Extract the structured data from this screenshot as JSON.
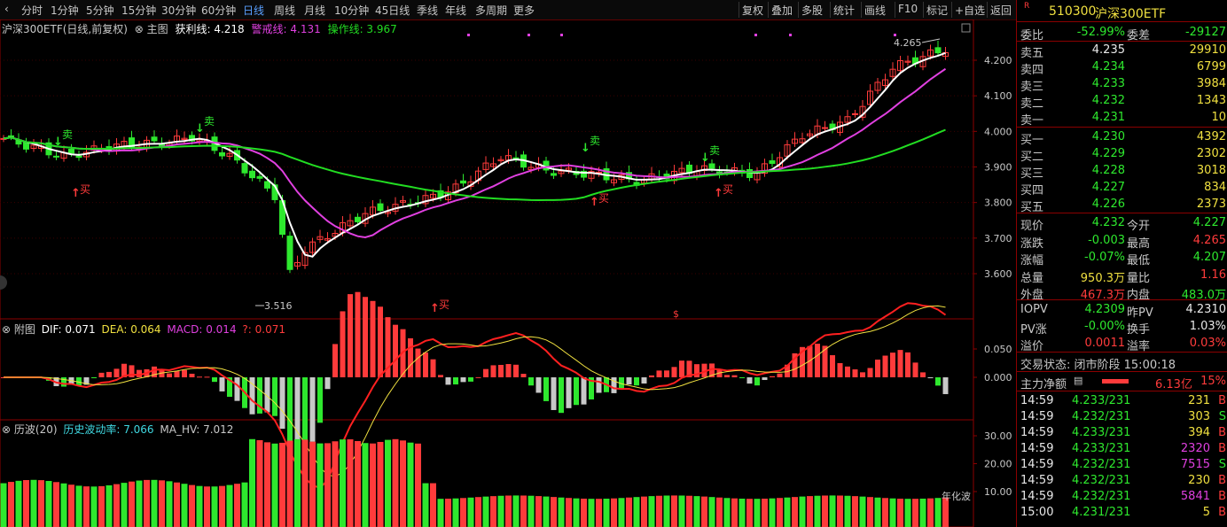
{
  "toolbar": {
    "periods": [
      "分时",
      "1分钟",
      "5分钟",
      "15分钟",
      "30分钟",
      "60分钟",
      "日线",
      "周线",
      "月线",
      "10分钟",
      "45日线",
      "季线",
      "年线",
      "多周期",
      "更多"
    ],
    "active_period": "日线",
    "right_buttons": [
      "复权",
      "叠加",
      "多股",
      "统计",
      "画线",
      "F10",
      "标记",
      "+自选",
      "返回"
    ]
  },
  "main_header": {
    "title": "沪深300ETF(日线,前复权)",
    "label": "主图",
    "profit_line": "获利线: 4.218",
    "warn_line": "警戒线: 4.131",
    "op_line": "操作线: 3.967"
  },
  "main_chart": {
    "y_ticks": [
      "4.200",
      "4.100",
      "4.000",
      "3.900",
      "3.800",
      "3.700",
      "3.600"
    ],
    "high_label": "4.265",
    "low_label": "3.516",
    "signals": [
      {
        "text": "卖",
        "kind": "sell"
      },
      {
        "text": "买",
        "kind": "buy"
      },
      {
        "text": "卖",
        "kind": "sell"
      },
      {
        "text": "买",
        "kind": "buy"
      },
      {
        "text": "卖",
        "kind": "sell"
      },
      {
        "text": "买",
        "kind": "buy"
      },
      {
        "text": "卖",
        "kind": "sell"
      },
      {
        "text": "买",
        "kind": "buy"
      }
    ],
    "dollar_mark": "$"
  },
  "macd_header": {
    "label": "附图",
    "dif": "DIF: 0.071",
    "dea": "DEA: 0.064",
    "macd": "MACD: 0.014",
    "extra": "?: 0.071"
  },
  "macd_chart": {
    "y_ticks": [
      "0.050",
      "0.000"
    ]
  },
  "vol_header": {
    "label": "历波(20)",
    "hv": "历史波动率: 7.066",
    "ma_hv": "MA_HV: 7.012"
  },
  "vol_chart": {
    "y_ticks": [
      "30.00",
      "20.00",
      "10.00"
    ],
    "annual_label": "年化波"
  },
  "quote": {
    "code": "510300",
    "name": "沪深300ETF",
    "ratio_label": "委比",
    "ratio": "-52.99%",
    "diff_label": "委差",
    "diff": "-29127",
    "asks": [
      {
        "label": "卖五",
        "price": "4.235",
        "vol": "29910"
      },
      {
        "label": "卖四",
        "price": "4.234",
        "vol": "6799"
      },
      {
        "label": "卖三",
        "price": "4.233",
        "vol": "3984"
      },
      {
        "label": "卖二",
        "price": "4.232",
        "vol": "1343"
      },
      {
        "label": "卖一",
        "price": "4.231",
        "vol": "10"
      }
    ],
    "bids": [
      {
        "label": "买一",
        "price": "4.230",
        "vol": "4392"
      },
      {
        "label": "买二",
        "price": "4.229",
        "vol": "2302"
      },
      {
        "label": "买三",
        "price": "4.228",
        "vol": "3018"
      },
      {
        "label": "买四",
        "price": "4.227",
        "vol": "834"
      },
      {
        "label": "买五",
        "price": "4.226",
        "vol": "2373"
      }
    ],
    "stats": [
      {
        "l1": "现价",
        "v1": "4.232",
        "l2": "今开",
        "v2": "4.227"
      },
      {
        "l1": "涨跌",
        "v1": "-0.003",
        "l2": "最高",
        "v2": "4.265"
      },
      {
        "l1": "涨幅",
        "v1": "-0.07%",
        "l2": "最低",
        "v2": "4.207"
      },
      {
        "l1": "总量",
        "v1": "950.3万",
        "l2": "量比",
        "v2": "1.16"
      },
      {
        "l1": "外盘",
        "v1": "467.3万",
        "l2": "内盘",
        "v2": "483.0万"
      }
    ],
    "iopv": [
      {
        "l1": "IOPV",
        "v1": "4.2309",
        "l2": "昨PV",
        "v2": "4.2310"
      },
      {
        "l1": "PV涨",
        "v1": "-0.00%",
        "l2": "换手",
        "v2": "1.03%"
      },
      {
        "l1": "溢价",
        "v1": "0.0011",
        "l2": "溢率",
        "v2": "0.03%"
      }
    ],
    "trade_status": "交易状态: 闭市阶段 15:00:18",
    "main_net_label": "主力净额",
    "main_net_value": "6.13亿",
    "main_net_pct": "15%",
    "ticks": [
      {
        "time": "14:59",
        "price": "4.233/231",
        "vol": "231",
        "side": "B"
      },
      {
        "time": "14:59",
        "price": "4.232/231",
        "vol": "303",
        "side": "S"
      },
      {
        "time": "14:59",
        "price": "4.233/231",
        "vol": "394",
        "side": "B"
      },
      {
        "time": "14:59",
        "price": "4.233/231",
        "vol": "2320",
        "side": "B"
      },
      {
        "time": "14:59",
        "price": "4.232/231",
        "vol": "7515",
        "side": "S"
      },
      {
        "time": "14:59",
        "price": "4.232/231",
        "vol": "230",
        "side": "B"
      },
      {
        "time": "14:59",
        "price": "4.232/231",
        "vol": "5841",
        "side": "B"
      },
      {
        "time": "15:00",
        "price": "4.231/231",
        "vol": "5",
        "side": "B"
      }
    ]
  },
  "colors": {
    "up": "#ff3b3b",
    "down": "#2ee82e",
    "ma_white": "#ffffff",
    "ma_magenta": "#e040e0",
    "ma_green": "#22dd22"
  }
}
